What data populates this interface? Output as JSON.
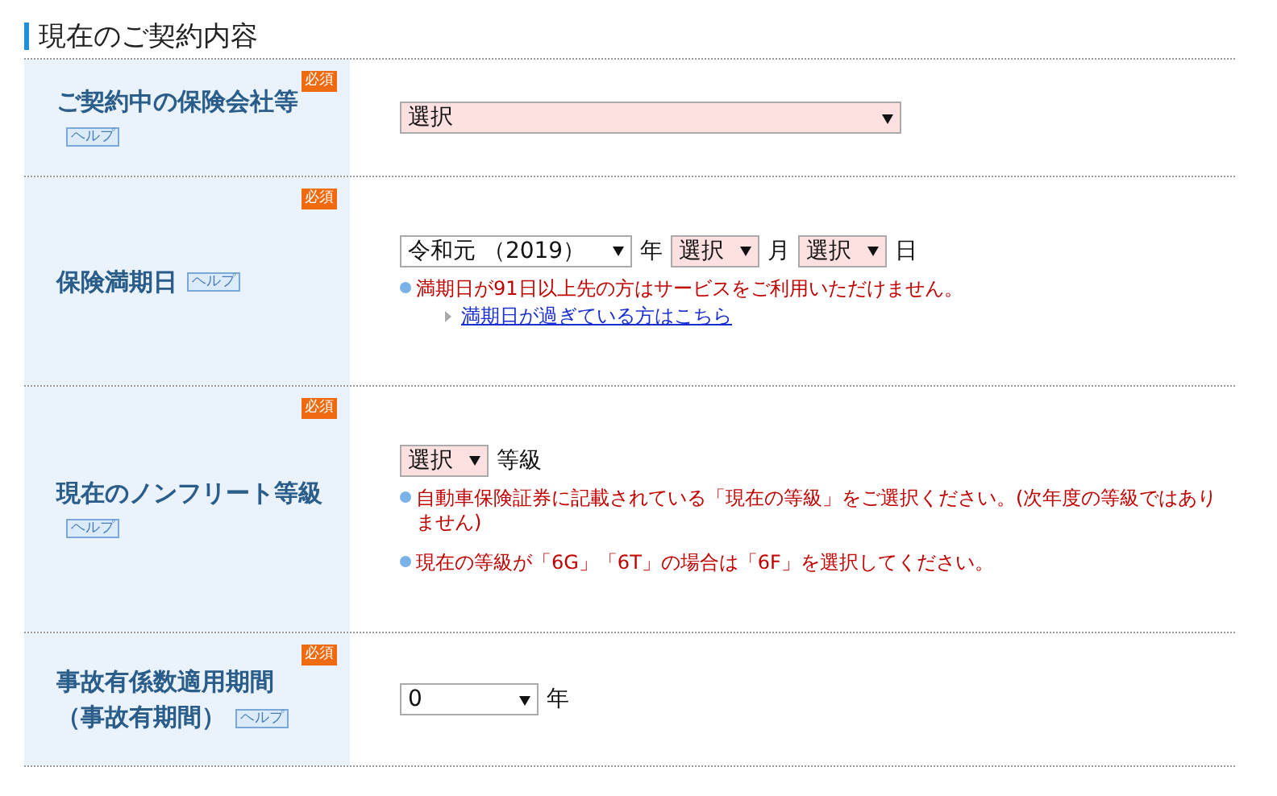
{
  "section_title": "現在のご契約内容",
  "rows": [
    {
      "label": [
        "ご契約中の保険会社等"
      ],
      "required": "必須",
      "help": "ヘルプ",
      "controls": [
        {
          "kind": "select",
          "value": "選択",
          "highlight": true
        }
      ]
    },
    {
      "label": [
        "保険満期日"
      ],
      "required": "必須",
      "help": "ヘルプ",
      "controls": [
        {
          "kind": "select",
          "value": "令和元 （2019）",
          "highlight": false
        },
        {
          "kind": "text",
          "value": "年"
        },
        {
          "kind": "select",
          "value": "選択",
          "highlight": true
        },
        {
          "kind": "text",
          "value": "月"
        },
        {
          "kind": "select",
          "value": "選択",
          "highlight": true
        },
        {
          "kind": "text",
          "value": "日"
        }
      ],
      "notes": [
        {
          "kind": "note",
          "text": "満期日が91日以上先の方はサービスをご利用いただけません。"
        },
        {
          "kind": "link",
          "text": "満期日が過ぎている方はこちら"
        }
      ]
    },
    {
      "label": [
        "現在のノンフリート等級"
      ],
      "required": "必須",
      "help": "ヘルプ",
      "controls": [
        {
          "kind": "select",
          "value": "選択",
          "highlight": true
        },
        {
          "kind": "text",
          "value": "等級"
        }
      ],
      "notes": [
        {
          "kind": "note",
          "text": "自動車保険証券に記載されている「現在の等級」をご選択ください。(次年度の等級ではありません)"
        },
        {
          "kind": "note",
          "text": "現在の等級が「6G」「6T」の場合は「6F」を選択してください。"
        }
      ]
    },
    {
      "label": [
        "事故有係数適用期間",
        "（事故有期間）"
      ],
      "required": "必須",
      "help": "ヘルプ",
      "controls": [
        {
          "kind": "select",
          "value": "0",
          "highlight": false
        },
        {
          "kind": "text",
          "value": "年"
        }
      ]
    }
  ]
}
